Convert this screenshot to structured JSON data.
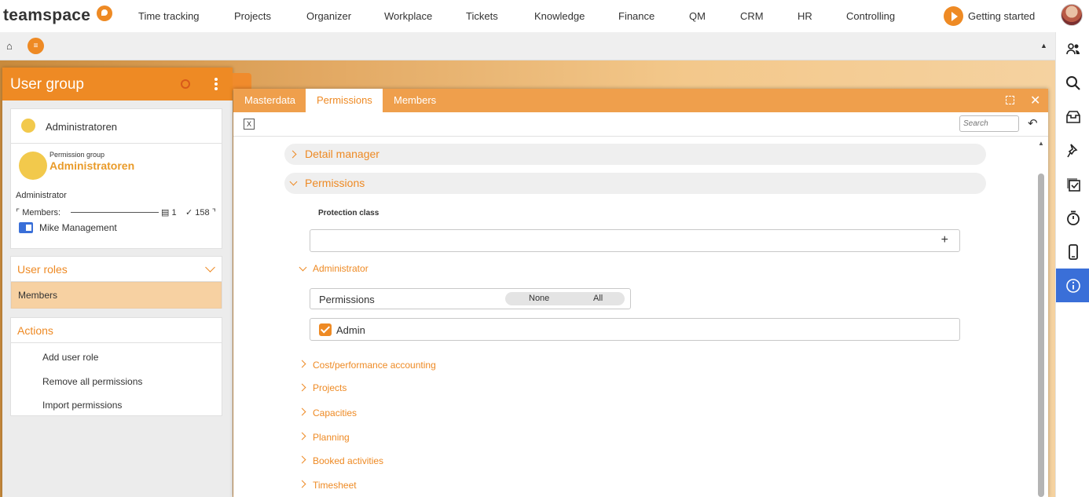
{
  "topnav": {
    "logo": "teamspace",
    "items": [
      "Time tracking",
      "Projects",
      "Organizer",
      "Workplace",
      "Tickets",
      "Knowledge",
      "Finance",
      "QM",
      "CRM",
      "HR",
      "Controlling"
    ],
    "getting_started": "Getting started"
  },
  "leftpanel": {
    "title": "User group",
    "group_name": "Administratoren",
    "perm_group_small": "Permission group",
    "perm_group_name": "Administratoren",
    "admin_text": "Administrator",
    "members_label": "Members:",
    "members_count": "1",
    "members_check": "158",
    "member_name": "Mike Management",
    "user_roles_title": "User roles",
    "members_item": "Members",
    "actions_title": "Actions",
    "actions": [
      "Add user role",
      "Remove all permissions",
      "Import permissions"
    ]
  },
  "main": {
    "tabs": [
      "Masterdata",
      "Permissions",
      "Members"
    ],
    "active_tab": "Permissions",
    "search_placeholder": "Search",
    "detail_manager": "Detail manager",
    "permissions_section": "Permissions",
    "protection_class": "Protection class",
    "administrator": "Administrator",
    "permissions_label": "Permissions",
    "none": "None",
    "all": "All",
    "admin_label": "Admin",
    "admin_checked": true,
    "sub_sections": [
      "Cost/performance accounting",
      "Projects",
      "Capacities",
      "Planning",
      "Booked activities",
      "Timesheet"
    ]
  },
  "colors": {
    "accent": "#ee8a24",
    "tabbar": "#ef9f4c",
    "rail_active": "#3a6fd8"
  },
  "rail_icons": [
    "people-icon",
    "search-icon",
    "inbox-icon",
    "pin-icon",
    "task-check-icon",
    "stopwatch-icon",
    "mobile-icon",
    "info-icon"
  ]
}
